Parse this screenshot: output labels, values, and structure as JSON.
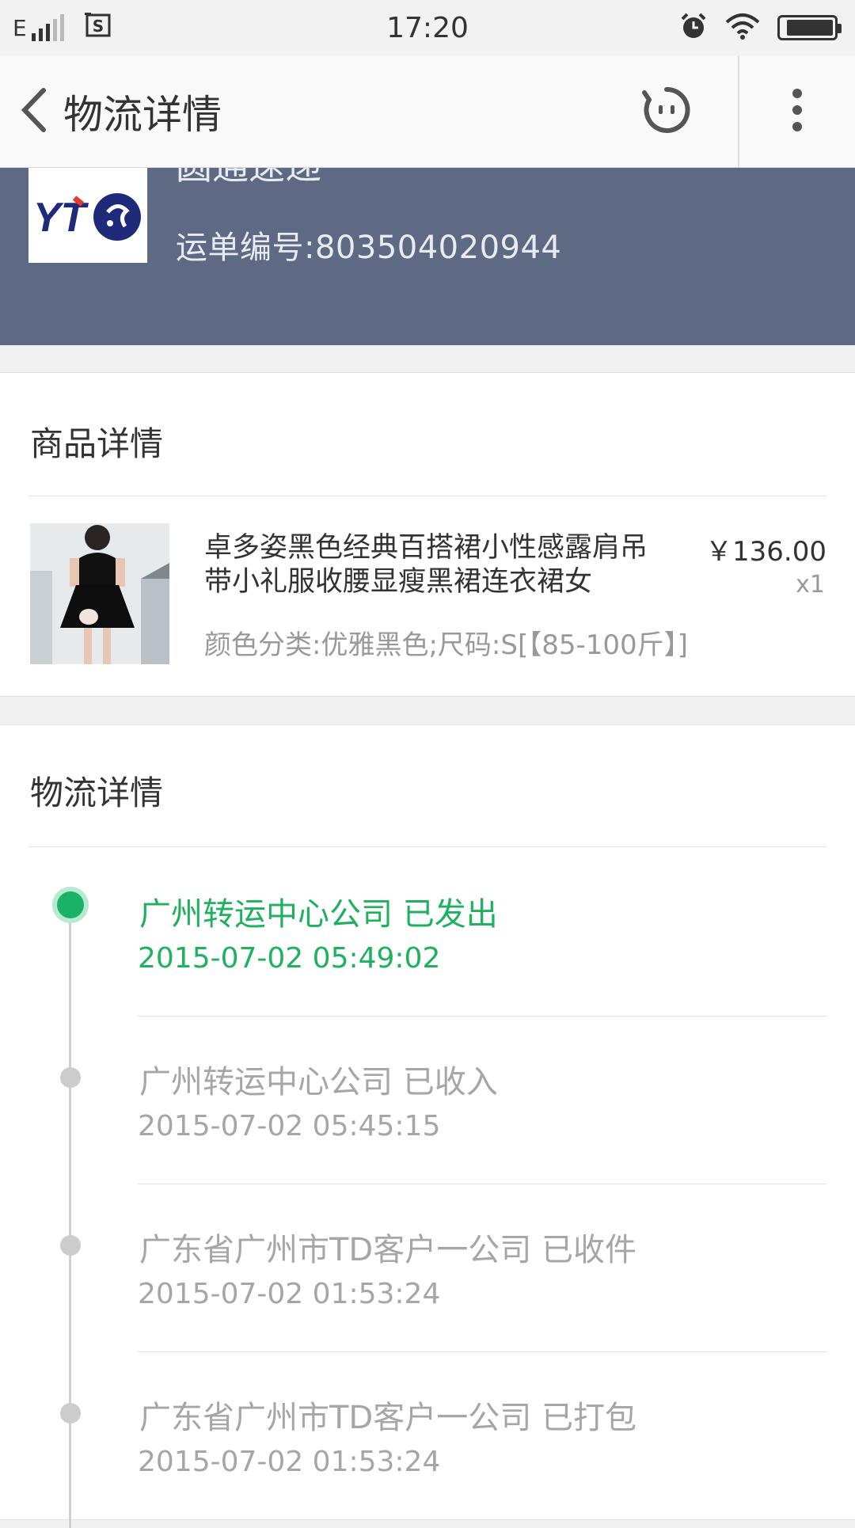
{
  "status_bar": {
    "network": "E",
    "time": "17:20",
    "battery_level": 0.9
  },
  "nav": {
    "title": "物流详情"
  },
  "carrier": {
    "name": "圆通速递",
    "tracking_label": "运单编号:803504020944",
    "logo_text": "YT"
  },
  "product_section": {
    "title": "商品详情",
    "name": "卓多姿黑色经典百搭裙小性感露肩吊带小礼服收腰显瘦黑裙连衣裙女",
    "price": "￥136.00",
    "qty": "x1",
    "sku": "颜色分类:优雅黑色;尺码:S[【85-100斤】]"
  },
  "logistics_section": {
    "title": "物流详情",
    "events": [
      {
        "title": "广州转运中心公司 已发出",
        "time": "2015-07-02 05:49:02"
      },
      {
        "title": "广州转运中心公司 已收入",
        "time": "2015-07-02 05:45:15"
      },
      {
        "title": "广东省广州市TD客户一公司 已收件",
        "time": "2015-07-02 01:53:24"
      },
      {
        "title": "广东省广州市TD客户一公司 已打包",
        "time": "2015-07-02 01:53:24"
      }
    ]
  },
  "colors": {
    "banner": "#5e6a84",
    "active_green": "#1fb15e",
    "muted_gray": "#a6a6a6"
  }
}
